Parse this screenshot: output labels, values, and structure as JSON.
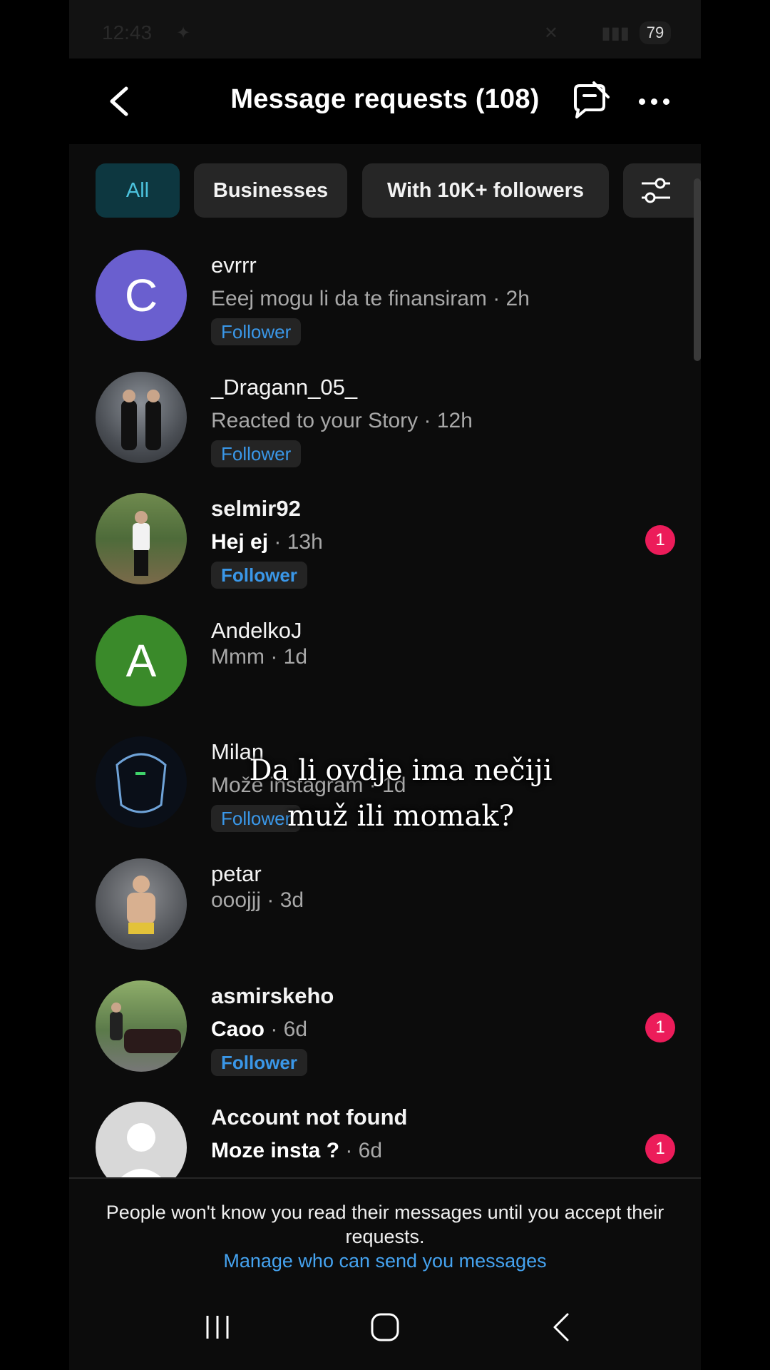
{
  "status_bar": {
    "time": "12:43",
    "battery": "79"
  },
  "header": {
    "title": "Message requests (108)"
  },
  "filters": [
    {
      "label": "All"
    },
    {
      "label": "Businesses"
    },
    {
      "label": "With 10K+ followers"
    }
  ],
  "requests": [
    {
      "username": "evrrr",
      "message": "Eeej mogu li da te finansiram",
      "time": "· 2h",
      "badge": "Follower",
      "unread": null,
      "avatar_letter": "C",
      "avatar_color": "#6a5fcf"
    },
    {
      "username": "_Dragann_05_",
      "message": "Reacted to your Story",
      "time": "· 12h",
      "badge": "Follower",
      "unread": null,
      "avatar_letter": "",
      "avatar_color": "#5a5f66"
    },
    {
      "username": "selmir92",
      "message": "Hej ej",
      "time": "· 13h",
      "badge": "Follower",
      "unread": "1",
      "avatar_letter": "",
      "avatar_color": "#4e6b3a"
    },
    {
      "username": "AndelkoJ",
      "message": "Mmm",
      "time": "· 1d",
      "badge": null,
      "unread": null,
      "avatar_letter": "A",
      "avatar_color": "#3a8a2a"
    },
    {
      "username": "Milan",
      "message": "Može instagram",
      "time": "· 1d",
      "badge": "Follower",
      "unread": null,
      "avatar_letter": "",
      "avatar_color": "#0a0f18"
    },
    {
      "username": "petar",
      "message": "ooojjj",
      "time": "· 3d",
      "badge": null,
      "unread": null,
      "avatar_letter": "",
      "avatar_color": "#4d5055"
    },
    {
      "username": "asmirskeho",
      "message": "Caoo",
      "time": "· 6d",
      "badge": "Follower",
      "unread": "1",
      "avatar_letter": "",
      "avatar_color": "#5b7a4a"
    },
    {
      "username": "Account not found",
      "message": "Moze insta ?",
      "time": "· 6d",
      "badge": null,
      "unread": "1",
      "avatar_letter": "",
      "avatar_color": "#d8d8d8"
    }
  ],
  "caption": "Da li ovdje ima nečiji muž ili momak?",
  "footer": {
    "notice": "People won't know you read their messages until you accept their requests.",
    "link": "Manage who can send you messages"
  },
  "colors": {
    "accent_blue": "#3a97e8",
    "unread_badge": "#ec1c5a",
    "active_chip_bg": "#0d3740",
    "active_chip_text": "#4cc3de"
  }
}
